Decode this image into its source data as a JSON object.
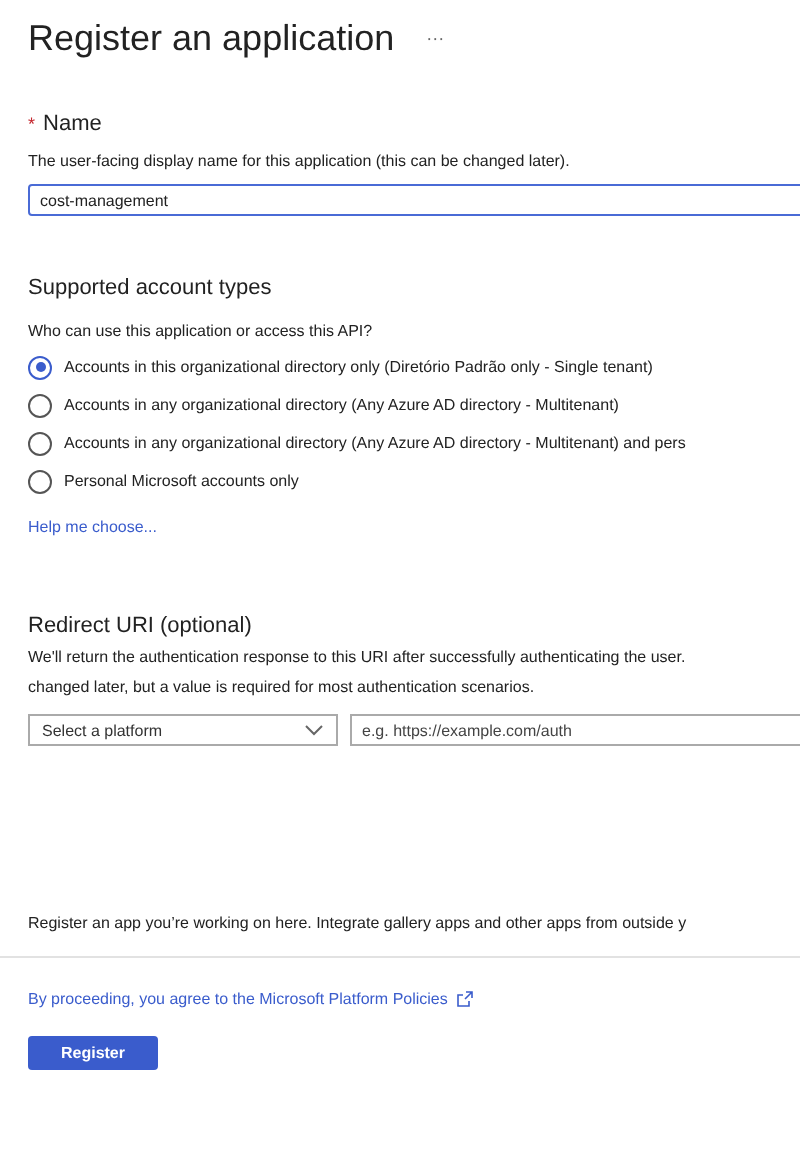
{
  "page": {
    "title": "Register an application",
    "more": "···"
  },
  "name_section": {
    "required_mark": "*",
    "label": "Name",
    "description": "The user-facing display name for this application (this can be changed later).",
    "value": "cost-management"
  },
  "account_types": {
    "heading": "Supported account types",
    "question": "Who can use this application or access this API?",
    "options": [
      {
        "label": "Accounts in this organizational directory only (Diretório Padrão only - Single tenant)",
        "selected": true
      },
      {
        "label": "Accounts in any organizational directory (Any Azure AD directory - Multitenant)",
        "selected": false
      },
      {
        "label": "Accounts in any organizational directory (Any Azure AD directory - Multitenant) and pers",
        "selected": false
      },
      {
        "label": "Personal Microsoft accounts only",
        "selected": false
      }
    ],
    "help_link": "Help me choose..."
  },
  "redirect": {
    "heading": "Redirect URI (optional)",
    "description_lines": [
      "We'll return the authentication response to this URI after successfully authenticating the user.",
      "changed later, but a value is required for most authentication scenarios."
    ],
    "platform_select": "Select a platform",
    "uri_placeholder": "e.g. https://example.com/auth"
  },
  "footer": {
    "note": "Register an app you’re working on here. Integrate gallery apps and other apps from outside y",
    "policy_link": "By proceeding, you agree to the Microsoft Platform Policies",
    "register_button": "Register"
  }
}
